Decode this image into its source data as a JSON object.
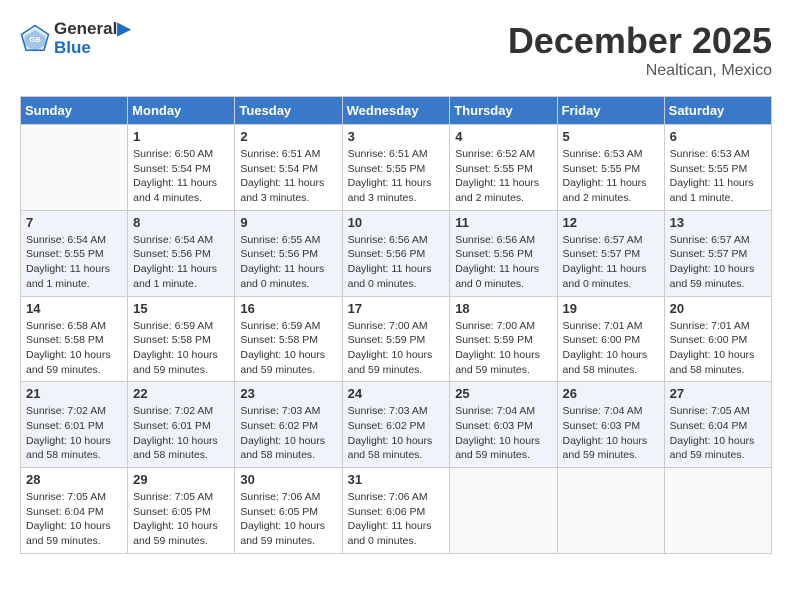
{
  "header": {
    "logo_line1": "General",
    "logo_line2": "Blue",
    "month_title": "December 2025",
    "location": "Nealtican, Mexico"
  },
  "calendar": {
    "days_of_week": [
      "Sunday",
      "Monday",
      "Tuesday",
      "Wednesday",
      "Thursday",
      "Friday",
      "Saturday"
    ],
    "weeks": [
      [
        {
          "day": "",
          "info": ""
        },
        {
          "day": "1",
          "info": "Sunrise: 6:50 AM\nSunset: 5:54 PM\nDaylight: 11 hours\nand 4 minutes."
        },
        {
          "day": "2",
          "info": "Sunrise: 6:51 AM\nSunset: 5:54 PM\nDaylight: 11 hours\nand 3 minutes."
        },
        {
          "day": "3",
          "info": "Sunrise: 6:51 AM\nSunset: 5:55 PM\nDaylight: 11 hours\nand 3 minutes."
        },
        {
          "day": "4",
          "info": "Sunrise: 6:52 AM\nSunset: 5:55 PM\nDaylight: 11 hours\nand 2 minutes."
        },
        {
          "day": "5",
          "info": "Sunrise: 6:53 AM\nSunset: 5:55 PM\nDaylight: 11 hours\nand 2 minutes."
        },
        {
          "day": "6",
          "info": "Sunrise: 6:53 AM\nSunset: 5:55 PM\nDaylight: 11 hours\nand 1 minute."
        }
      ],
      [
        {
          "day": "7",
          "info": "Sunrise: 6:54 AM\nSunset: 5:55 PM\nDaylight: 11 hours\nand 1 minute."
        },
        {
          "day": "8",
          "info": "Sunrise: 6:54 AM\nSunset: 5:56 PM\nDaylight: 11 hours\nand 1 minute."
        },
        {
          "day": "9",
          "info": "Sunrise: 6:55 AM\nSunset: 5:56 PM\nDaylight: 11 hours\nand 0 minutes."
        },
        {
          "day": "10",
          "info": "Sunrise: 6:56 AM\nSunset: 5:56 PM\nDaylight: 11 hours\nand 0 minutes."
        },
        {
          "day": "11",
          "info": "Sunrise: 6:56 AM\nSunset: 5:56 PM\nDaylight: 11 hours\nand 0 minutes."
        },
        {
          "day": "12",
          "info": "Sunrise: 6:57 AM\nSunset: 5:57 PM\nDaylight: 11 hours\nand 0 minutes."
        },
        {
          "day": "13",
          "info": "Sunrise: 6:57 AM\nSunset: 5:57 PM\nDaylight: 10 hours\nand 59 minutes."
        }
      ],
      [
        {
          "day": "14",
          "info": "Sunrise: 6:58 AM\nSunset: 5:58 PM\nDaylight: 10 hours\nand 59 minutes."
        },
        {
          "day": "15",
          "info": "Sunrise: 6:59 AM\nSunset: 5:58 PM\nDaylight: 10 hours\nand 59 minutes."
        },
        {
          "day": "16",
          "info": "Sunrise: 6:59 AM\nSunset: 5:58 PM\nDaylight: 10 hours\nand 59 minutes."
        },
        {
          "day": "17",
          "info": "Sunrise: 7:00 AM\nSunset: 5:59 PM\nDaylight: 10 hours\nand 59 minutes."
        },
        {
          "day": "18",
          "info": "Sunrise: 7:00 AM\nSunset: 5:59 PM\nDaylight: 10 hours\nand 59 minutes."
        },
        {
          "day": "19",
          "info": "Sunrise: 7:01 AM\nSunset: 6:00 PM\nDaylight: 10 hours\nand 58 minutes."
        },
        {
          "day": "20",
          "info": "Sunrise: 7:01 AM\nSunset: 6:00 PM\nDaylight: 10 hours\nand 58 minutes."
        }
      ],
      [
        {
          "day": "21",
          "info": "Sunrise: 7:02 AM\nSunset: 6:01 PM\nDaylight: 10 hours\nand 58 minutes."
        },
        {
          "day": "22",
          "info": "Sunrise: 7:02 AM\nSunset: 6:01 PM\nDaylight: 10 hours\nand 58 minutes."
        },
        {
          "day": "23",
          "info": "Sunrise: 7:03 AM\nSunset: 6:02 PM\nDaylight: 10 hours\nand 58 minutes."
        },
        {
          "day": "24",
          "info": "Sunrise: 7:03 AM\nSunset: 6:02 PM\nDaylight: 10 hours\nand 58 minutes."
        },
        {
          "day": "25",
          "info": "Sunrise: 7:04 AM\nSunset: 6:03 PM\nDaylight: 10 hours\nand 59 minutes."
        },
        {
          "day": "26",
          "info": "Sunrise: 7:04 AM\nSunset: 6:03 PM\nDaylight: 10 hours\nand 59 minutes."
        },
        {
          "day": "27",
          "info": "Sunrise: 7:05 AM\nSunset: 6:04 PM\nDaylight: 10 hours\nand 59 minutes."
        }
      ],
      [
        {
          "day": "28",
          "info": "Sunrise: 7:05 AM\nSunset: 6:04 PM\nDaylight: 10 hours\nand 59 minutes."
        },
        {
          "day": "29",
          "info": "Sunrise: 7:05 AM\nSunset: 6:05 PM\nDaylight: 10 hours\nand 59 minutes."
        },
        {
          "day": "30",
          "info": "Sunrise: 7:06 AM\nSunset: 6:05 PM\nDaylight: 10 hours\nand 59 minutes."
        },
        {
          "day": "31",
          "info": "Sunrise: 7:06 AM\nSunset: 6:06 PM\nDaylight: 11 hours\nand 0 minutes."
        },
        {
          "day": "",
          "info": ""
        },
        {
          "day": "",
          "info": ""
        },
        {
          "day": "",
          "info": ""
        }
      ]
    ]
  }
}
